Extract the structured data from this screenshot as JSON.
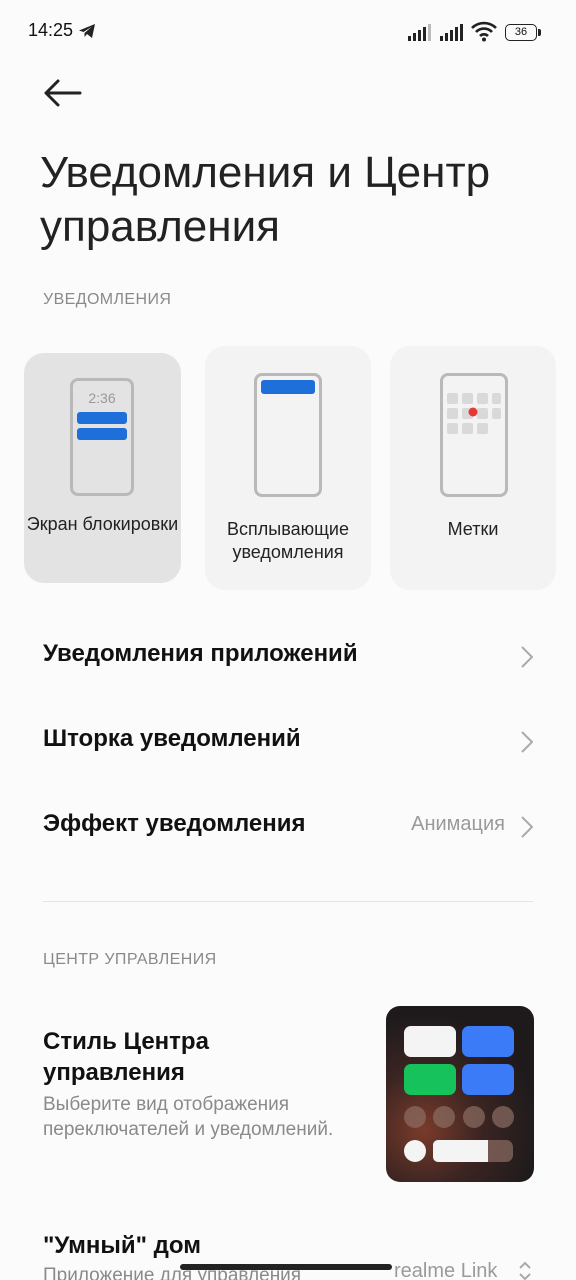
{
  "status_bar": {
    "time": "14:25",
    "battery": "36"
  },
  "page": {
    "title": "Уведомления и Центр управления"
  },
  "notifications": {
    "section_title": "УВЕДОМЛЕНИЯ",
    "cards": [
      {
        "label": "Экран блокировки",
        "preview_time": "2:36",
        "selected": true
      },
      {
        "label": "Всплывающие уведомления",
        "selected": false
      },
      {
        "label": "Метки",
        "selected": false
      }
    ],
    "rows": [
      {
        "title": "Уведомления приложений",
        "value": ""
      },
      {
        "title": "Шторка уведомлений",
        "value": ""
      },
      {
        "title": "Эффект уведомления",
        "value": "Анимация"
      }
    ]
  },
  "control_center": {
    "section_title": "ЦЕНТР УПРАВЛЕНИЯ",
    "style_title": "Стиль Центра управления",
    "style_description": "Выберите вид отображения переключателей и уведомлений.",
    "smart_home_title": "\"Умный\" дом",
    "smart_home_description": "Приложение для управления",
    "smart_home_value": "realme Link"
  },
  "colors": {
    "accent": "#1e6fd9",
    "badge": "#e53935",
    "tile_green": "#16c25c",
    "tile_blue": "#3b7bf7"
  }
}
